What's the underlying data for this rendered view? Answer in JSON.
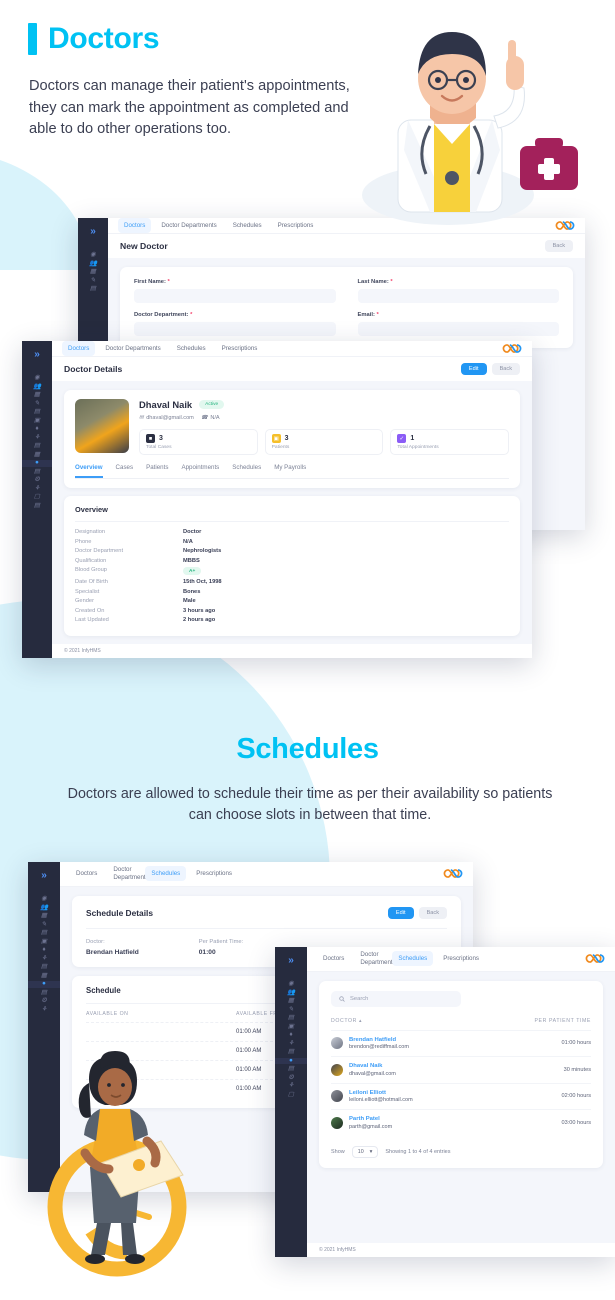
{
  "sections": {
    "doctors": {
      "title": "Doctors",
      "description": "Doctors can manage their patient's appointments, they can mark the appointment as completed and able to do other operations too."
    },
    "schedules": {
      "title": "Schedules",
      "description": "Doctors are allowed to schedule their time as per their availability so patients can choose slots in between that time."
    }
  },
  "colors": {
    "accent": "#00c2f3",
    "primary_button": "#2196f3",
    "sidebar": "#262b3e",
    "decor": "#d9f3fb",
    "link": "#3d9df7",
    "required": "#f4436c",
    "success": "#24b47e"
  },
  "nav_tabs": [
    {
      "label": "Doctors",
      "active": true
    },
    {
      "label": "Doctor Departments",
      "active": false
    },
    {
      "label": "Schedules",
      "active": false
    },
    {
      "label": "Prescriptions",
      "active": false
    }
  ],
  "nav_tabs_schedules": [
    {
      "label": "Doctors",
      "active": false
    },
    {
      "label": "Doctor Departments",
      "active": false
    },
    {
      "label": "Schedules",
      "active": true
    },
    {
      "label": "Prescriptions",
      "active": false
    }
  ],
  "logo": "infinity-logo",
  "sidebar_icons": [
    "dashboard-icon",
    "users-icon",
    "clipboard-icon",
    "pencil-icon",
    "document-icon",
    "calendar-icon",
    "drop-icon",
    "stethoscope-icon",
    "file-icon",
    "building-icon",
    "doctor-icon",
    "report-icon",
    "nurse-icon",
    "staff-icon",
    "invoice-icon",
    "note-icon"
  ],
  "new_doctor": {
    "page_title": "New Doctor",
    "back_label": "Back",
    "fields": [
      {
        "label": "First Name:",
        "required": true,
        "value": ""
      },
      {
        "label": "Last Name:",
        "required": true,
        "value": ""
      },
      {
        "label": "Doctor Department:",
        "required": true,
        "value": ""
      },
      {
        "label": "Email:",
        "required": true,
        "value": ""
      }
    ]
  },
  "doctor_details": {
    "page_title": "Doctor Details",
    "edit_label": "Edit",
    "back_label": "Back",
    "name": "Dhaval Naik",
    "status": "Active",
    "email": "dhaval@gmail.com",
    "phone": "N/A",
    "stats": [
      {
        "icon": "case-icon",
        "value": "3",
        "label": "Total Cases",
        "color": "#2b2f42"
      },
      {
        "icon": "calendar-icon",
        "value": "3",
        "label": "Patients",
        "color": "#f5bf2a"
      },
      {
        "icon": "appointment-icon",
        "value": "1",
        "label": "Total Appointments",
        "color": "#8b5cf6"
      }
    ],
    "tabs": [
      {
        "label": "Overview",
        "active": true
      },
      {
        "label": "Cases",
        "active": false
      },
      {
        "label": "Patients",
        "active": false
      },
      {
        "label": "Appointments",
        "active": false
      },
      {
        "label": "Schedules",
        "active": false
      },
      {
        "label": "My Payrolls",
        "active": false
      }
    ],
    "overview_title": "Overview",
    "overview_rows": [
      {
        "key": "Designation",
        "value": "Doctor"
      },
      {
        "key": "Phone",
        "value": "N/A"
      },
      {
        "key": "Doctor Department",
        "value": "Nephrologists"
      },
      {
        "key": "Qualification",
        "value": "MBBS"
      },
      {
        "key": "Blood Group",
        "value": "A+",
        "pill": true
      },
      {
        "key": "Date Of Birth",
        "value": "15th Oct, 1998"
      },
      {
        "key": "Specialist",
        "value": "Bones"
      },
      {
        "key": "Gender",
        "value": "Male"
      },
      {
        "key": "Created On",
        "value": "3 hours ago"
      },
      {
        "key": "Last Updated",
        "value": "2 hours ago"
      }
    ],
    "footer": "© 2021 InfyHMS"
  },
  "schedule_details": {
    "page_title": "Schedule Details",
    "edit_label": "Edit",
    "back_label": "Back",
    "doctor_key": "Doctor:",
    "doctor_value": "Brendan Hatfield",
    "time_key": "Per Patient Time:",
    "time_value": "01:00",
    "schedule_title": "Schedule",
    "columns": [
      "AVAILABLE ON",
      "AVAILABLE FROM"
    ],
    "rows": [
      {
        "day": "",
        "from": "01:00 AM"
      },
      {
        "day": "",
        "from": "01:00 AM"
      },
      {
        "day": "",
        "from": "01:00 AM"
      },
      {
        "day": "",
        "from": "01:00 AM"
      }
    ]
  },
  "doctor_list": {
    "search_placeholder": "Search",
    "columns": [
      "DOCTOR",
      "PER PATIENT TIME"
    ],
    "rows": [
      {
        "name": "Brendan Hatfield",
        "email": "brendon@rediffmail.com",
        "time": "01:00 hours"
      },
      {
        "name": "Dhaval Naik",
        "email": "dhaval@gmail.com",
        "time": "30 minutes"
      },
      {
        "name": "Leiloni Elliott",
        "email": "leiloni.elliott@hotmail.com",
        "time": "02:00 hours"
      },
      {
        "name": "Parth Patel",
        "email": "parth@gmail.com",
        "time": "03:00 hours"
      }
    ],
    "show_label": "Show",
    "show_value": "10",
    "entries_info": "Showing 1 to 4 of 4 entries",
    "footer": "© 2021 InfyHMS"
  }
}
